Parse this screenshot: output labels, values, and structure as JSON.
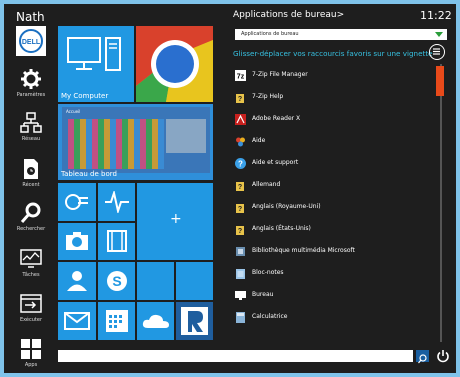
{
  "user": {
    "name": "Nath",
    "avatar_label": "DELL"
  },
  "rail": [
    {
      "label": "Paramètres",
      "icon": "gear-icon"
    },
    {
      "label": "Réseau",
      "icon": "network-icon"
    },
    {
      "label": "Récent",
      "icon": "recent-documents-icon"
    },
    {
      "label": "Rechercher",
      "icon": "search-icon"
    },
    {
      "label": "Tâches",
      "icon": "tasks-icon"
    },
    {
      "label": "Exécuter",
      "icon": "run-icon"
    },
    {
      "label": "Apps",
      "icon": "apps-grid-icon"
    }
  ],
  "tiles": {
    "my_computer": "My Computer",
    "dashboard": "Tableau de bord",
    "dashboard_mini_title": "Accueil",
    "add_symbol": "+"
  },
  "panel": {
    "title": "Applications de bureau>",
    "clock": "11:22",
    "dropdown_value": "Applications de bureau",
    "hint": "Glisser-déplacer vos raccourcis favoris sur une vignette"
  },
  "apps": [
    {
      "label": "7-Zip File Manager",
      "icon": "7zip-icon"
    },
    {
      "label": "7-Zip Help",
      "icon": "help-file-icon"
    },
    {
      "label": "Adobe Reader X",
      "icon": "adobe-reader-icon"
    },
    {
      "label": "Aide",
      "icon": "help-people-icon"
    },
    {
      "label": "Aide et support",
      "icon": "question-icon"
    },
    {
      "label": "Allemand",
      "icon": "help-file-icon"
    },
    {
      "label": "Anglais (Royaume-Uni)",
      "icon": "help-file-icon"
    },
    {
      "label": "Anglais (États-Unis)",
      "icon": "help-file-icon"
    },
    {
      "label": "Bibliothèque multimédia Microsoft",
      "icon": "media-library-icon"
    },
    {
      "label": "Bloc-notes",
      "icon": "notepad-icon"
    },
    {
      "label": "Bureau",
      "icon": "desktop-icon"
    },
    {
      "label": "Calculatrice",
      "icon": "calculator-icon"
    }
  ],
  "colors": {
    "accent": "#2198e2",
    "hint": "#37c0e0",
    "scroll_thumb": "#e84a1a",
    "background": "#1e1e1e"
  }
}
